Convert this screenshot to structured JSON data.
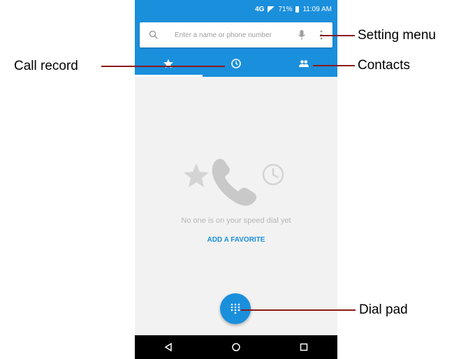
{
  "status_bar": {
    "network": "4G",
    "battery": "71%",
    "time": "11:09 AM"
  },
  "search": {
    "placeholder": "Enter a name or phone number"
  },
  "tabs": [
    {
      "icon": "star-icon",
      "active": true
    },
    {
      "icon": "clock-icon",
      "active": false
    },
    {
      "icon": "people-icon",
      "active": false
    }
  ],
  "empty_state": {
    "message": "No one is on your speed dial yet",
    "action": "ADD A FAVORITE"
  },
  "annotations": {
    "setting_menu": "Setting menu",
    "call_record": "Call record",
    "contacts": "Contacts",
    "dial_pad": "Dial pad"
  },
  "colors": {
    "primary": "#1a8fdc",
    "leader_line": "#8b1a1a"
  }
}
